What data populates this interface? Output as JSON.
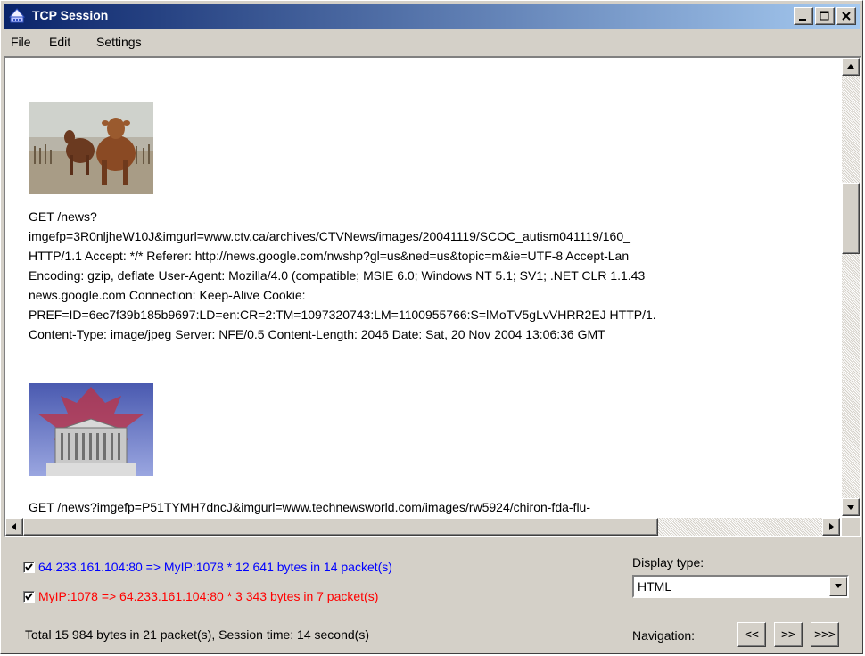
{
  "window": {
    "title": "TCP Session"
  },
  "menu": {
    "file": "File",
    "edit": "Edit",
    "settings": "Settings"
  },
  "content": {
    "request1": [
      "GET /news?",
      "imgefp=3R0nljheW10J&imgurl=www.ctv.ca/archives/CTVNews/images/20041119/SCOC_autism041119/160_",
      "HTTP/1.1 Accept: */* Referer: http://news.google.com/nwshp?gl=us&ned=us&topic=m&ie=UTF-8 Accept-Lan",
      "Encoding: gzip, deflate User-Agent: Mozilla/4.0 (compatible; MSIE 6.0; Windows NT 5.1; SV1; .NET CLR 1.1.43",
      "news.google.com Connection: Keep-Alive Cookie:",
      "PREF=ID=6ec7f39b185b9697:LD=en:CR=2:TM=1097320743:LM=1100955766:S=lMoTV5gLvVHRR2EJ HTTP/1.",
      "Content-Type: image/jpeg Server: NFE/0.5 Content-Length: 2046 Date: Sat, 20 Nov 2004 13:06:36 GMT"
    ],
    "request2": [
      "GET /news?imgefp=P51TYMH7dncJ&imgurl=www.technewsworld.com/images/rw5924/chiron-fda-flu-"
    ]
  },
  "streams": {
    "incoming": {
      "checked": true,
      "label": "64.233.161.104:80 => MyIP:1078 * 12 641 bytes in 14 packet(s)",
      "color": "#0000ff"
    },
    "outgoing": {
      "checked": true,
      "label": "MyIP:1078 => 64.233.161.104:80 * 3 343 bytes in 7 packet(s)",
      "color": "#ff0000"
    },
    "total": "Total 15 984 bytes in 21 packet(s), Session time: 14 second(s)"
  },
  "display": {
    "label": "Display type:",
    "selected": "HTML"
  },
  "navigation": {
    "label": "Navigation:",
    "first": "<<",
    "next": ">>",
    "last": ">>>"
  }
}
